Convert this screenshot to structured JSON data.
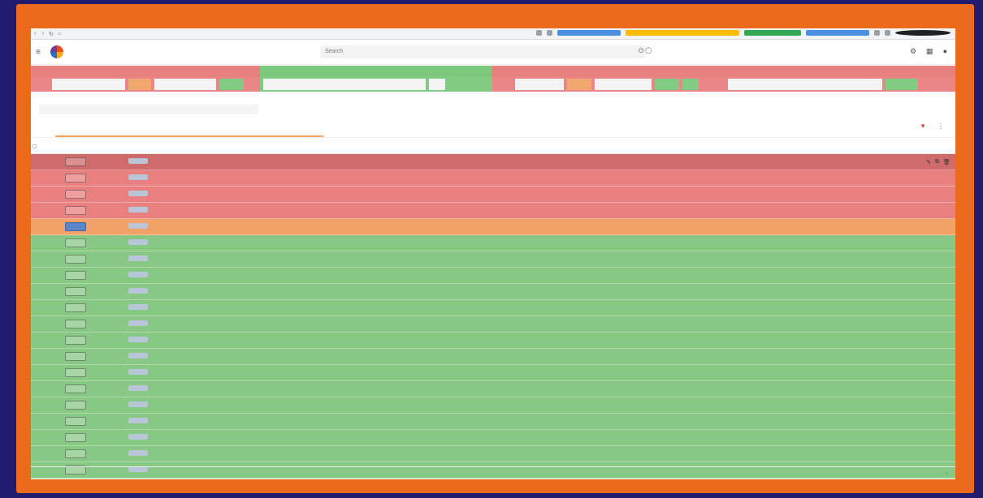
{
  "browser": {
    "url": ""
  },
  "app": {
    "search_placeholder": "Search"
  },
  "groups": [
    {
      "title": "",
      "color": "#e98080",
      "cells": [
        {
          "t": "",
          "k": "r",
          "w": 18
        },
        {
          "t": "",
          "k": "w",
          "w": 90
        },
        {
          "t": "",
          "k": "o",
          "w": 28
        },
        {
          "t": "",
          "k": "w",
          "w": 76
        },
        {
          "t": "",
          "k": "g",
          "w": 30
        }
      ],
      "width": 282
    },
    {
      "title": "",
      "color": "#7cc97c",
      "cells": [
        {
          "t": "",
          "k": "w",
          "w": 200
        },
        {
          "t": "",
          "k": "w",
          "w": 20
        },
        {
          "t": "",
          "k": "g",
          "w": 30
        }
      ],
      "width": 286
    },
    {
      "title": "",
      "color": "#e98080",
      "cells": [
        {
          "t": "",
          "k": "r",
          "w": 20
        },
        {
          "t": "",
          "k": "w",
          "w": 60
        },
        {
          "t": "",
          "k": "o",
          "w": 30
        },
        {
          "t": "",
          "k": "w",
          "w": 70
        },
        {
          "t": "",
          "k": "g",
          "w": 30
        },
        {
          "t": "",
          "k": "g",
          "w": 20
        }
      ],
      "width": 286
    },
    {
      "title": "",
      "color": "#e98080",
      "cells": [
        {
          "t": "",
          "k": "w",
          "w": 190
        },
        {
          "t": "",
          "k": "g",
          "w": 40
        }
      ],
      "width": 284
    }
  ],
  "subfilter": {
    "title": "",
    "values": [
      "",
      "",
      ""
    ]
  },
  "tabs": {
    "left": "",
    "center": ""
  },
  "table": {
    "headers": [
      "",
      "",
      "",
      "",
      "",
      "",
      "",
      "",
      "",
      "",
      ""
    ],
    "rows": [
      {
        "cls": "redtop",
        "vals": [
          "",
          "",
          "",
          "",
          "",
          "",
          "",
          "",
          "",
          ""
        ],
        "chipblue": false,
        "icons": true
      },
      {
        "cls": "red",
        "vals": [
          "",
          "",
          "",
          "",
          "",
          "",
          "",
          "",
          "",
          ""
        ],
        "chipblue": false
      },
      {
        "cls": "red",
        "vals": [
          "",
          "",
          "",
          "",
          "",
          "",
          "",
          "",
          "",
          ""
        ],
        "chipblue": false
      },
      {
        "cls": "red",
        "vals": [
          "",
          "",
          "",
          "",
          "",
          "",
          "",
          "",
          "",
          ""
        ],
        "chipblue": false
      },
      {
        "cls": "orange",
        "vals": [
          "",
          "",
          "",
          "",
          "",
          "",
          "",
          "",
          "",
          ""
        ],
        "chipblue": true
      },
      {
        "cls": "green",
        "vals": [
          "",
          "",
          "",
          "",
          "",
          "",
          "",
          "",
          "",
          ""
        ],
        "chipblue": false
      },
      {
        "cls": "green",
        "vals": [
          "",
          "",
          "",
          "",
          "",
          "",
          "",
          "",
          "",
          ""
        ],
        "chipblue": false
      },
      {
        "cls": "green",
        "vals": [
          "",
          "",
          "",
          "",
          "",
          "",
          "",
          "",
          "",
          ""
        ],
        "chipblue": false
      },
      {
        "cls": "green",
        "vals": [
          "",
          "",
          "",
          "",
          "",
          "",
          "",
          "",
          "",
          ""
        ],
        "chipblue": false
      },
      {
        "cls": "green",
        "vals": [
          "",
          "",
          "",
          "",
          "",
          "",
          "",
          "",
          "",
          ""
        ],
        "chipblue": false
      },
      {
        "cls": "green",
        "vals": [
          "",
          "",
          "",
          "",
          "",
          "",
          "",
          "",
          "",
          ""
        ],
        "chipblue": false
      },
      {
        "cls": "green",
        "vals": [
          "",
          "",
          "",
          "",
          "",
          "",
          "",
          "",
          "",
          ""
        ],
        "chipblue": false
      },
      {
        "cls": "green",
        "vals": [
          "",
          "",
          "",
          "",
          "",
          "",
          "",
          "",
          "",
          ""
        ],
        "chipblue": false
      },
      {
        "cls": "green",
        "vals": [
          "",
          "",
          "",
          "",
          "",
          "",
          "",
          "",
          "",
          ""
        ],
        "chipblue": false
      },
      {
        "cls": "green",
        "vals": [
          "",
          "",
          "",
          "",
          "",
          "",
          "",
          "",
          "",
          ""
        ],
        "chipblue": false
      },
      {
        "cls": "green",
        "vals": [
          "",
          "",
          "",
          "",
          "",
          "",
          "",
          "",
          "",
          ""
        ],
        "chipblue": false
      },
      {
        "cls": "green",
        "vals": [
          "",
          "",
          "",
          "",
          "",
          "",
          "",
          "",
          "",
          ""
        ],
        "chipblue": false
      },
      {
        "cls": "green",
        "vals": [
          "",
          "",
          "",
          "",
          "",
          "",
          "",
          "",
          "",
          ""
        ],
        "chipblue": false
      },
      {
        "cls": "green",
        "vals": [
          "",
          "",
          "",
          "",
          "",
          "",
          "",
          "",
          "",
          ""
        ],
        "chipblue": false
      },
      {
        "cls": "green",
        "vals": [
          "",
          "",
          "",
          "",
          "",
          "",
          "",
          "",
          "",
          ""
        ],
        "chipblue": false
      }
    ]
  },
  "footer": {
    "rows_per_page": "",
    "range": "",
    "pager": ""
  },
  "colors": {
    "frame": "#ec6a1c",
    "background": "#1f1b6e",
    "red": "#e98080",
    "orange": "#f2a266",
    "green": "#87c884"
  }
}
